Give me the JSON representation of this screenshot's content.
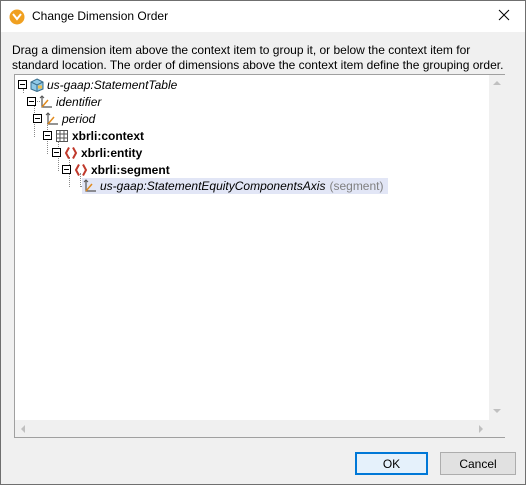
{
  "window": {
    "title": "Change Dimension Order",
    "app_icon": "altova-mapforce-icon",
    "close_icon": "close-icon"
  },
  "instructions": "Drag a dimension item above the context item to group it, or below the context item for standard location. The order of dimensions above the context item define the grouping order.",
  "tree": {
    "nodes": [
      {
        "label": "us-gaap:StatementTable",
        "icon": "table-cube-icon",
        "style": "italic",
        "expanded": true
      },
      {
        "label": "identifier",
        "icon": "dimension-axis-icon",
        "style": "italic",
        "expanded": true
      },
      {
        "label": "period",
        "icon": "dimension-axis-icon",
        "style": "italic",
        "expanded": true
      },
      {
        "label": "xbrli:context",
        "icon": "grid-element-icon",
        "style": "bold",
        "expanded": true
      },
      {
        "label": "xbrli:entity",
        "icon": "element-braces-icon",
        "style": "bold",
        "expanded": true
      },
      {
        "label": "xbrli:segment",
        "icon": "element-braces-icon",
        "style": "bold",
        "expanded": true
      },
      {
        "label": "us-gaap:StatementEquityComponentsAxis",
        "suffix": "(segment)",
        "icon": "dimension-axis-icon",
        "style": "italic",
        "selected": true
      }
    ]
  },
  "buttons": {
    "ok": "OK",
    "cancel": "Cancel"
  },
  "colors": {
    "selection": "#e2e6f6",
    "accent": "#0078d7",
    "element_red": "#c0392b"
  }
}
